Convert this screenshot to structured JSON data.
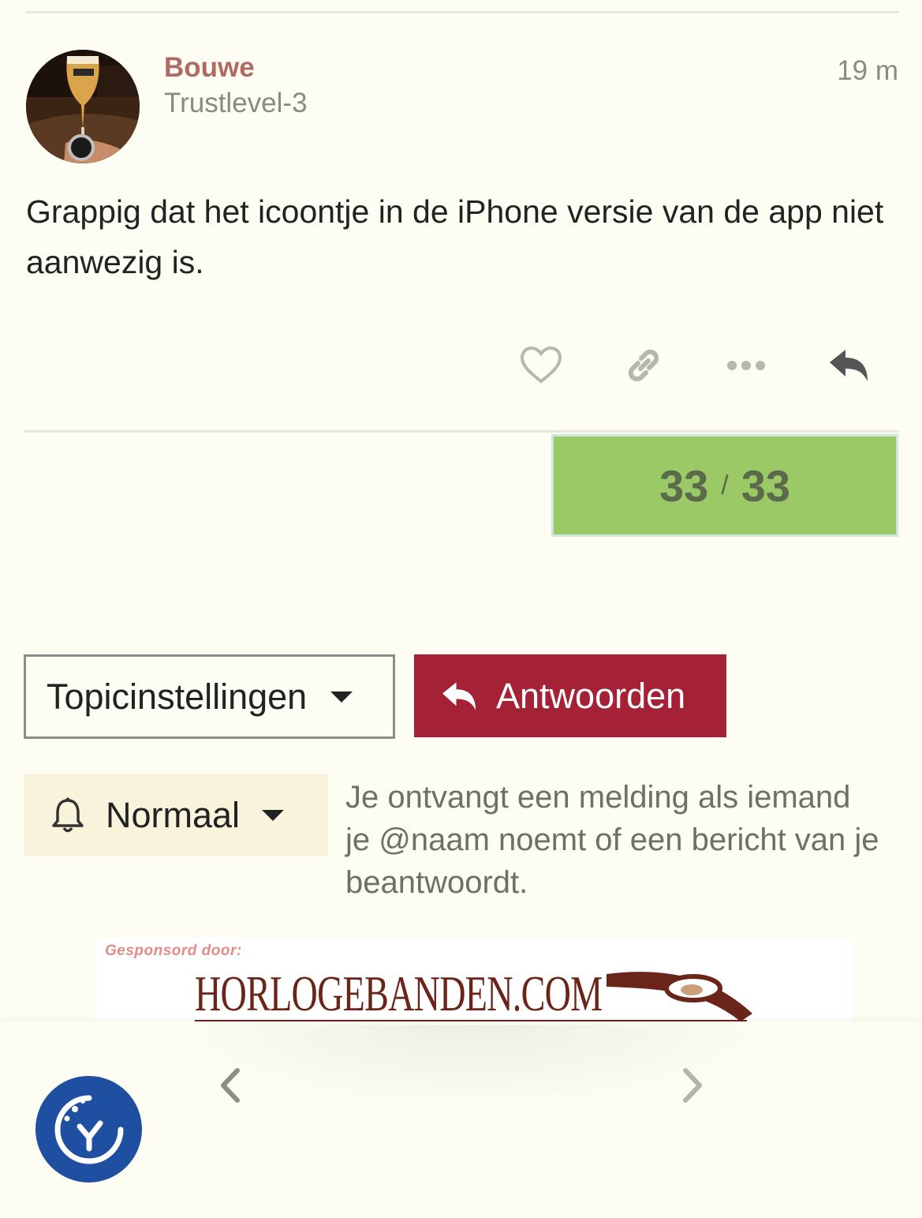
{
  "post": {
    "username": "Bouwe",
    "user_title": "Trustlevel-3",
    "time": "19 m",
    "body": "Grappig dat het icoontje in de iPhone versie van de app niet aanwezig is.",
    "actions": [
      "heart-icon",
      "link-icon",
      "more-icon",
      "reply-icon"
    ]
  },
  "progress": {
    "current": "33",
    "separator": "/",
    "total": "33",
    "color": "#9ac966"
  },
  "controls": {
    "topic_settings_label": "Topicinstellingen",
    "reply_label": "Antwoorden",
    "reply_color": "#a52236",
    "notification_level": "Normaal",
    "notification_description": "Je ontvangt een melding als iemand je @naam noemt of een bericht van je beantwoordt."
  },
  "sponsor": {
    "label": "Gesponsord door:",
    "brand": "HORLOGEBANDEN.COM"
  },
  "bottom_nav": {
    "icons": [
      "chevron-left-icon",
      "chevron-right-icon",
      "cookie-consent-icon"
    ]
  }
}
